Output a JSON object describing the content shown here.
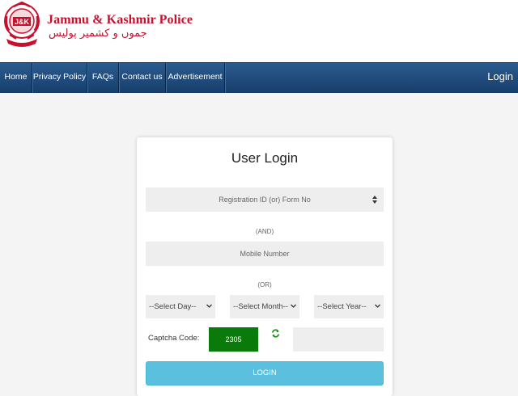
{
  "header": {
    "brand_en": "Jammu & Kashmir Police",
    "brand_ur": "جموں و کشمیر پولیس",
    "logo_icon": "jk-police-emblem-icon",
    "logo_text": "J&K"
  },
  "nav": {
    "items": [
      {
        "label": "Home"
      },
      {
        "label": "Privacy Policy"
      },
      {
        "label": "FAQs"
      },
      {
        "label": "Contact us"
      },
      {
        "label": "Advertisement"
      }
    ],
    "login_label": "Login"
  },
  "form": {
    "title": "User Login",
    "registration_select": "Registration ID (or) Form No",
    "and_label": "(AND)",
    "mobile_placeholder": "Mobile Number",
    "or_label": "(OR)",
    "day_select": "--Select Day--",
    "month_select": "--Select Month--",
    "year_select": "--Select Year--",
    "captcha_label": "Captcha Code:",
    "captcha_value": "2305",
    "captcha_input_value": "",
    "login_button": "LOGIN"
  },
  "colors": {
    "brand_red": "#c8102e",
    "nav_blue": "#1f4b7c",
    "captcha_green": "#0a7a0a",
    "button_info": "#5bc0de"
  }
}
